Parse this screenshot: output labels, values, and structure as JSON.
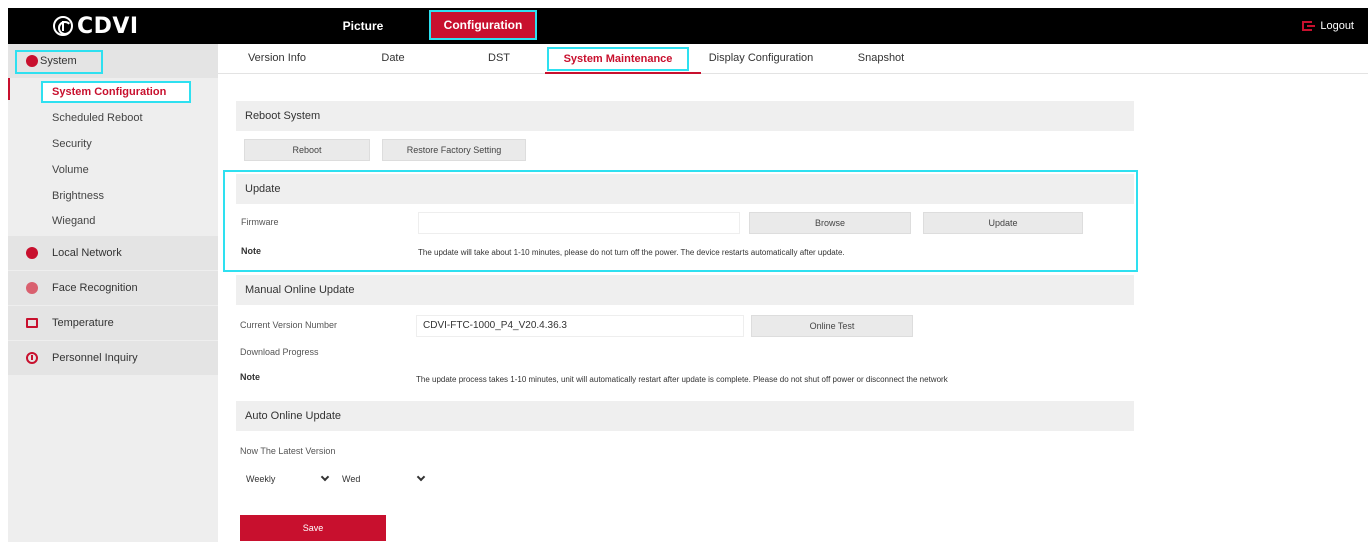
{
  "header": {
    "logo_text": "CDVI",
    "nav": {
      "picture": "Picture",
      "configuration": "Configuration"
    },
    "logout": "Logout"
  },
  "sidebar": {
    "system": "System",
    "system_items": [
      "System Configuration",
      "Scheduled Reboot",
      "Security",
      "Volume",
      "Brightness",
      "Wiegand"
    ],
    "groups": [
      "Local Network",
      "Face Recognition",
      "Temperature",
      "Personnel Inquiry"
    ]
  },
  "tabs": [
    "Version Info",
    "Date",
    "DST",
    "System Maintenance",
    "Display Configuration",
    "Snapshot"
  ],
  "reboot": {
    "title": "Reboot System",
    "reboot_btn": "Reboot",
    "restore_btn": "Restore Factory Setting"
  },
  "update": {
    "title": "Update",
    "firmware_label": "Firmware",
    "firmware_value": "",
    "browse_btn": "Browse",
    "update_btn": "Update",
    "note_label": "Note",
    "note_text": "The update will take about 1-10 minutes, please do not turn off the power. The device restarts automatically after update."
  },
  "manual": {
    "title": "Manual Online Update",
    "version_label": "Current Version Number",
    "version_value": "CDVI-FTC-1000_P4_V20.4.36.3",
    "online_test_btn": "Online Test",
    "progress_label": "Download Progress",
    "note_label": "Note",
    "note_text": "The update process takes 1-10 minutes, unit will automatically restart after update is complete. Please do not shut off power or disconnect the network"
  },
  "auto": {
    "title": "Auto Online Update",
    "latest_label": "Now The Latest Version",
    "frequency": "Weekly",
    "day": "Wed"
  },
  "save_btn": "Save",
  "colors": {
    "accent": "#c8102e",
    "highlight": "#2ee0f0",
    "topbar": "#000000"
  }
}
